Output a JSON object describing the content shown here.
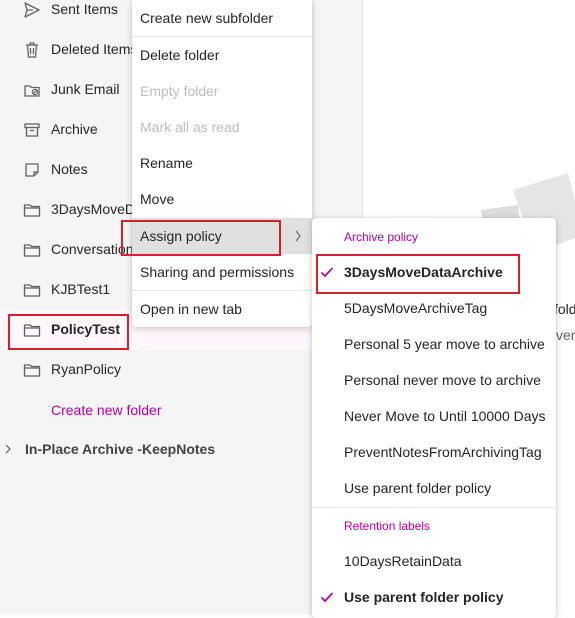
{
  "colors": {
    "accent": "#b4009e",
    "highlight": "#d6202c"
  },
  "folders": [
    {
      "label": "Sent Items",
      "icon": "send-icon"
    },
    {
      "label": "Deleted Items",
      "icon": "trash-icon"
    },
    {
      "label": "Junk Email",
      "icon": "junk-icon"
    },
    {
      "label": "Archive",
      "icon": "archive-icon"
    },
    {
      "label": "Notes",
      "icon": "note-icon"
    },
    {
      "label": "3DaysMoveD",
      "icon": "folder-icon"
    },
    {
      "label": "Conversation",
      "icon": "folder-icon"
    },
    {
      "label": "KJBTest1",
      "icon": "folder-icon"
    },
    {
      "label": "PolicyTest",
      "icon": "folder-icon",
      "selected": true
    },
    {
      "label": "RyanPolicy",
      "icon": "folder-icon"
    }
  ],
  "create_folder": "Create new folder",
  "group": {
    "label": "In-Place Archive -KeepNotes",
    "icon": "chevron-right-icon"
  },
  "context_menu": {
    "items": [
      {
        "label": "Create new subfolder"
      },
      {
        "label": "Delete folder"
      },
      {
        "label": "Empty folder",
        "disabled": true
      },
      {
        "label": "Mark all as read",
        "disabled": true
      },
      {
        "label": "Rename"
      },
      {
        "label": "Move"
      },
      {
        "label": "Assign policy",
        "has_submenu": true,
        "hovered": true
      },
      {
        "label": "Sharing and permissions"
      },
      {
        "label": "Open in new tab"
      }
    ]
  },
  "submenu": {
    "archive_header": "Archive policy",
    "archive_items": [
      {
        "label": "3DaysMoveDataArchive",
        "checked": true
      },
      {
        "label": "5DaysMoveArchiveTag"
      },
      {
        "label": "Personal 5 year move to archive"
      },
      {
        "label": "Personal never move to archive"
      },
      {
        "label": "Never Move to Until 10000 Days"
      },
      {
        "label": "PreventNotesFromArchivingTag"
      },
      {
        "label": "Use parent folder policy"
      }
    ],
    "retention_header": "Retention labels",
    "retention_items": [
      {
        "label": "10DaysRetainData"
      },
      {
        "label": "Use parent folder policy",
        "checked": true
      }
    ]
  },
  "reading_pane": {
    "peek_1": "fold",
    "peek_2": "ver"
  }
}
